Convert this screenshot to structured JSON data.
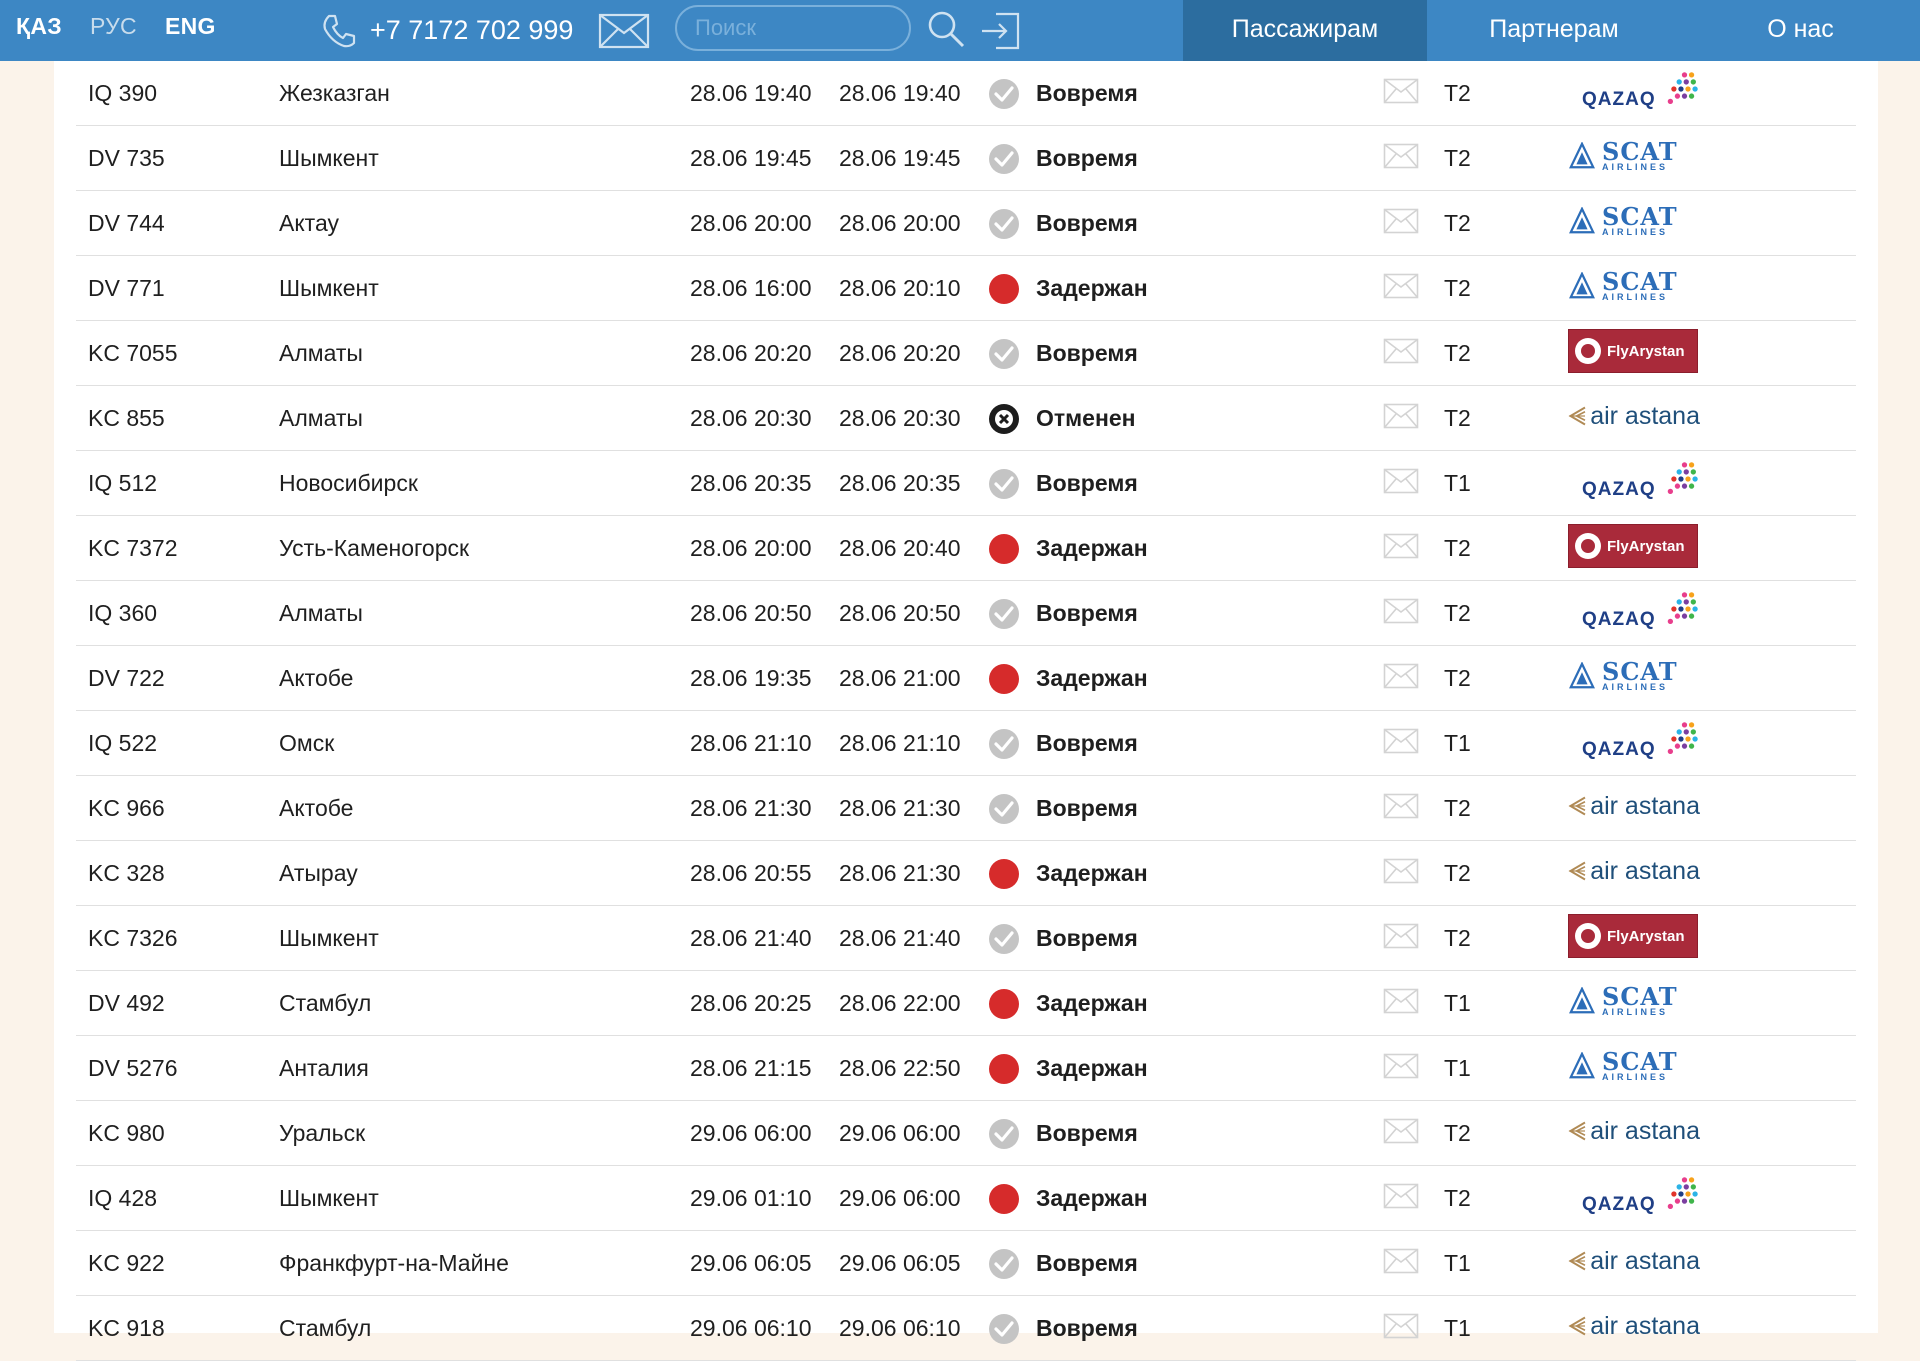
{
  "header": {
    "languages": [
      "ҚАЗ",
      "РУС",
      "ENG"
    ],
    "phone": "+7 7172 702 999",
    "search_placeholder": "Поиск",
    "nav": [
      "Пассажирам",
      "Партнерам",
      "О нас"
    ]
  },
  "colors": {
    "header": "#3d87c4",
    "nav_active": "#2c6d9f",
    "status_ok": "#c4c4c4",
    "status_delayed": "#d62b2b",
    "status_cancelled": "#1d1d1d"
  },
  "logo_text": {
    "flyarystan": "FlyArystan",
    "air_astana": "air astana",
    "scat": "SCAT",
    "scat_sub": "AIRLINES",
    "qazaq": "QAZAQ"
  },
  "flights": [
    {
      "flight": "IQ 390",
      "city": "Жезказган",
      "scheduled": "28.06 19:40",
      "actual": "28.06 19:40",
      "status": "Вовремя",
      "state": "ok",
      "terminal": "T2",
      "airline": "qazaq"
    },
    {
      "flight": "DV 735",
      "city": "Шымкент",
      "scheduled": "28.06 19:45",
      "actual": "28.06 19:45",
      "status": "Вовремя",
      "state": "ok",
      "terminal": "T2",
      "airline": "scat"
    },
    {
      "flight": "DV 744",
      "city": "Актау",
      "scheduled": "28.06 20:00",
      "actual": "28.06 20:00",
      "status": "Вовремя",
      "state": "ok",
      "terminal": "T2",
      "airline": "scat"
    },
    {
      "flight": "DV 771",
      "city": "Шымкент",
      "scheduled": "28.06 16:00",
      "actual": "28.06 20:10",
      "status": "Задержан",
      "state": "delayed",
      "terminal": "T2",
      "airline": "scat"
    },
    {
      "flight": "KC 7055",
      "city": "Алматы",
      "scheduled": "28.06 20:20",
      "actual": "28.06 20:20",
      "status": "Вовремя",
      "state": "ok",
      "terminal": "T2",
      "airline": "flyarystan"
    },
    {
      "flight": "KC 855",
      "city": "Алматы",
      "scheduled": "28.06 20:30",
      "actual": "28.06 20:30",
      "status": "Отменен",
      "state": "cancelled",
      "terminal": "T2",
      "airline": "air_astana"
    },
    {
      "flight": "IQ 512",
      "city": "Новосибирск",
      "scheduled": "28.06 20:35",
      "actual": "28.06 20:35",
      "status": "Вовремя",
      "state": "ok",
      "terminal": "T1",
      "airline": "qazaq"
    },
    {
      "flight": "KC 7372",
      "city": "Усть-Каменогорск",
      "scheduled": "28.06 20:00",
      "actual": "28.06 20:40",
      "status": "Задержан",
      "state": "delayed",
      "terminal": "T2",
      "airline": "flyarystan"
    },
    {
      "flight": "IQ 360",
      "city": "Алматы",
      "scheduled": "28.06 20:50",
      "actual": "28.06 20:50",
      "status": "Вовремя",
      "state": "ok",
      "terminal": "T2",
      "airline": "qazaq"
    },
    {
      "flight": "DV 722",
      "city": "Актобе",
      "scheduled": "28.06 19:35",
      "actual": "28.06 21:00",
      "status": "Задержан",
      "state": "delayed",
      "terminal": "T2",
      "airline": "scat"
    },
    {
      "flight": "IQ 522",
      "city": "Омск",
      "scheduled": "28.06 21:10",
      "actual": "28.06 21:10",
      "status": "Вовремя",
      "state": "ok",
      "terminal": "T1",
      "airline": "qazaq"
    },
    {
      "flight": "KC 966",
      "city": "Актобе",
      "scheduled": "28.06 21:30",
      "actual": "28.06 21:30",
      "status": "Вовремя",
      "state": "ok",
      "terminal": "T2",
      "airline": "air_astana"
    },
    {
      "flight": "KC 328",
      "city": "Атырау",
      "scheduled": "28.06 20:55",
      "actual": "28.06 21:30",
      "status": "Задержан",
      "state": "delayed",
      "terminal": "T2",
      "airline": "air_astana"
    },
    {
      "flight": "KC 7326",
      "city": "Шымкент",
      "scheduled": "28.06 21:40",
      "actual": "28.06 21:40",
      "status": "Вовремя",
      "state": "ok",
      "terminal": "T2",
      "airline": "flyarystan"
    },
    {
      "flight": "DV 492",
      "city": "Стамбул",
      "scheduled": "28.06 20:25",
      "actual": "28.06 22:00",
      "status": "Задержан",
      "state": "delayed",
      "terminal": "T1",
      "airline": "scat"
    },
    {
      "flight": "DV 5276",
      "city": "Анталия",
      "scheduled": "28.06 21:15",
      "actual": "28.06 22:50",
      "status": "Задержан",
      "state": "delayed",
      "terminal": "T1",
      "airline": "scat"
    },
    {
      "flight": "KC 980",
      "city": "Уральск",
      "scheduled": "29.06 06:00",
      "actual": "29.06 06:00",
      "status": "Вовремя",
      "state": "ok",
      "terminal": "T2",
      "airline": "air_astana"
    },
    {
      "flight": "IQ 428",
      "city": "Шымкент",
      "scheduled": "29.06 01:10",
      "actual": "29.06 06:00",
      "status": "Задержан",
      "state": "delayed",
      "terminal": "T2",
      "airline": "qazaq"
    },
    {
      "flight": "KC 922",
      "city": "Франкфурт-на-Майне",
      "scheduled": "29.06 06:05",
      "actual": "29.06 06:05",
      "status": "Вовремя",
      "state": "ok",
      "terminal": "T1",
      "airline": "air_astana"
    },
    {
      "flight": "KC 918",
      "city": "Стамбул",
      "scheduled": "29.06 06:10",
      "actual": "29.06 06:10",
      "status": "Вовремя",
      "state": "ok",
      "terminal": "T1",
      "airline": "air_astana"
    }
  ]
}
